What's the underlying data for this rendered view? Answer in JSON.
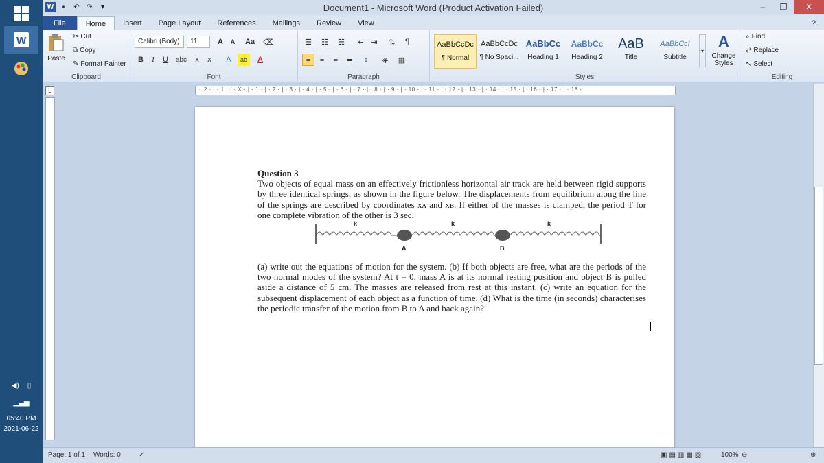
{
  "window": {
    "title": "Document1  -  Microsoft Word (Product Activation Failed)"
  },
  "tabs": [
    "File",
    "Home",
    "Insert",
    "Page Layout",
    "References",
    "Mailings",
    "Review",
    "View"
  ],
  "clipboard": {
    "paste": "Paste",
    "cut": "Cut",
    "copy": "Copy",
    "format_painter": "Format Painter",
    "label": "Clipboard"
  },
  "font": {
    "name": "Calibri (Body)",
    "size": "11",
    "label": "Font",
    "grow": "A",
    "shrink": "A",
    "case": "Aa",
    "bold": "B",
    "italic": "I",
    "underline": "U",
    "strike": "abc",
    "sub": "x",
    "sup": "x"
  },
  "paragraph": {
    "label": "Paragraph"
  },
  "styles": {
    "label": "Styles",
    "items": [
      {
        "preview": "AaBbCcDc",
        "name": "¶ Normal"
      },
      {
        "preview": "AaBbCcDc",
        "name": "¶ No Spaci..."
      },
      {
        "preview": "AaBbCc",
        "name": "Heading 1"
      },
      {
        "preview": "AaBbCc",
        "name": "Heading 2"
      },
      {
        "preview": "AaB",
        "name": "Title"
      },
      {
        "preview": "AaBbCcI",
        "name": "Subtitle"
      }
    ],
    "change": "Change Styles"
  },
  "editing": {
    "find": "Find",
    "replace": "Replace",
    "select": "Select",
    "label": "Editing"
  },
  "ruler": {
    "marks": "· 2 · | · 1 · | · X · | · 1 · | · 2 · | · 3 · | · 4 · | · 5 · | · 6 · | · 7 · | · 8 · | · 9 · | · 10 · | · 11 · | · 12 · | · 13 · | · 14 · | · 15 · | · 16 · | · 17 · | · 18 ·"
  },
  "document": {
    "heading": "Question 3",
    "para1": "Two objects of equal mass on an effectively frictionless horizontal air track are held between rigid supports by three identical springs, as shown in the figure below. The displacements from equilibrium along the line of the springs are described by coordinates xᴀ and xʙ. If either of the masses is clamped, the period T for one complete vibration of the other is 3 sec.",
    "figure": {
      "spring_label": "k",
      "mass_a": "A",
      "mass_b": "B"
    },
    "para2": "(a) write out the equations of motion for the system. (b) If both objects are free, what are the periods of the two normal modes of the system? At t = 0, mass A is at its normal resting position and object B is pulled aside a distance of 5 cm. The masses are released from rest at this instant. (c) write an equation for the subsequent displacement of each object as a function of time. (d) What is the time (in seconds) characterises the periodic transfer of the motion from B to A and back again?"
  },
  "status": {
    "page": "Page: 1 of 1",
    "words": "Words: 0",
    "zoom": "100%"
  },
  "system": {
    "time": "05:40 PM",
    "date": "2021-06-22"
  }
}
